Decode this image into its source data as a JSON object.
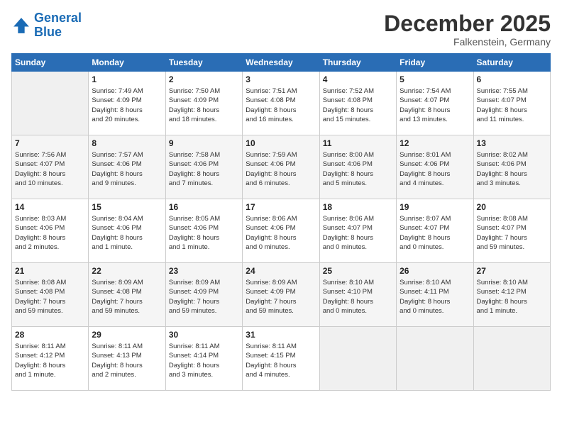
{
  "header": {
    "logo_line1": "General",
    "logo_line2": "Blue",
    "month": "December 2025",
    "location": "Falkenstein, Germany"
  },
  "weekdays": [
    "Sunday",
    "Monday",
    "Tuesday",
    "Wednesday",
    "Thursday",
    "Friday",
    "Saturday"
  ],
  "weeks": [
    [
      {
        "day": "",
        "info": ""
      },
      {
        "day": "1",
        "info": "Sunrise: 7:49 AM\nSunset: 4:09 PM\nDaylight: 8 hours\nand 20 minutes."
      },
      {
        "day": "2",
        "info": "Sunrise: 7:50 AM\nSunset: 4:09 PM\nDaylight: 8 hours\nand 18 minutes."
      },
      {
        "day": "3",
        "info": "Sunrise: 7:51 AM\nSunset: 4:08 PM\nDaylight: 8 hours\nand 16 minutes."
      },
      {
        "day": "4",
        "info": "Sunrise: 7:52 AM\nSunset: 4:08 PM\nDaylight: 8 hours\nand 15 minutes."
      },
      {
        "day": "5",
        "info": "Sunrise: 7:54 AM\nSunset: 4:07 PM\nDaylight: 8 hours\nand 13 minutes."
      },
      {
        "day": "6",
        "info": "Sunrise: 7:55 AM\nSunset: 4:07 PM\nDaylight: 8 hours\nand 11 minutes."
      }
    ],
    [
      {
        "day": "7",
        "info": "Sunrise: 7:56 AM\nSunset: 4:07 PM\nDaylight: 8 hours\nand 10 minutes."
      },
      {
        "day": "8",
        "info": "Sunrise: 7:57 AM\nSunset: 4:06 PM\nDaylight: 8 hours\nand 9 minutes."
      },
      {
        "day": "9",
        "info": "Sunrise: 7:58 AM\nSunset: 4:06 PM\nDaylight: 8 hours\nand 7 minutes."
      },
      {
        "day": "10",
        "info": "Sunrise: 7:59 AM\nSunset: 4:06 PM\nDaylight: 8 hours\nand 6 minutes."
      },
      {
        "day": "11",
        "info": "Sunrise: 8:00 AM\nSunset: 4:06 PM\nDaylight: 8 hours\nand 5 minutes."
      },
      {
        "day": "12",
        "info": "Sunrise: 8:01 AM\nSunset: 4:06 PM\nDaylight: 8 hours\nand 4 minutes."
      },
      {
        "day": "13",
        "info": "Sunrise: 8:02 AM\nSunset: 4:06 PM\nDaylight: 8 hours\nand 3 minutes."
      }
    ],
    [
      {
        "day": "14",
        "info": "Sunrise: 8:03 AM\nSunset: 4:06 PM\nDaylight: 8 hours\nand 2 minutes."
      },
      {
        "day": "15",
        "info": "Sunrise: 8:04 AM\nSunset: 4:06 PM\nDaylight: 8 hours\nand 1 minute."
      },
      {
        "day": "16",
        "info": "Sunrise: 8:05 AM\nSunset: 4:06 PM\nDaylight: 8 hours\nand 1 minute."
      },
      {
        "day": "17",
        "info": "Sunrise: 8:06 AM\nSunset: 4:06 PM\nDaylight: 8 hours\nand 0 minutes."
      },
      {
        "day": "18",
        "info": "Sunrise: 8:06 AM\nSunset: 4:07 PM\nDaylight: 8 hours\nand 0 minutes."
      },
      {
        "day": "19",
        "info": "Sunrise: 8:07 AM\nSunset: 4:07 PM\nDaylight: 8 hours\nand 0 minutes."
      },
      {
        "day": "20",
        "info": "Sunrise: 8:08 AM\nSunset: 4:07 PM\nDaylight: 7 hours\nand 59 minutes."
      }
    ],
    [
      {
        "day": "21",
        "info": "Sunrise: 8:08 AM\nSunset: 4:08 PM\nDaylight: 7 hours\nand 59 minutes."
      },
      {
        "day": "22",
        "info": "Sunrise: 8:09 AM\nSunset: 4:08 PM\nDaylight: 7 hours\nand 59 minutes."
      },
      {
        "day": "23",
        "info": "Sunrise: 8:09 AM\nSunset: 4:09 PM\nDaylight: 7 hours\nand 59 minutes."
      },
      {
        "day": "24",
        "info": "Sunrise: 8:09 AM\nSunset: 4:09 PM\nDaylight: 7 hours\nand 59 minutes."
      },
      {
        "day": "25",
        "info": "Sunrise: 8:10 AM\nSunset: 4:10 PM\nDaylight: 8 hours\nand 0 minutes."
      },
      {
        "day": "26",
        "info": "Sunrise: 8:10 AM\nSunset: 4:11 PM\nDaylight: 8 hours\nand 0 minutes."
      },
      {
        "day": "27",
        "info": "Sunrise: 8:10 AM\nSunset: 4:12 PM\nDaylight: 8 hours\nand 1 minute."
      }
    ],
    [
      {
        "day": "28",
        "info": "Sunrise: 8:11 AM\nSunset: 4:12 PM\nDaylight: 8 hours\nand 1 minute."
      },
      {
        "day": "29",
        "info": "Sunrise: 8:11 AM\nSunset: 4:13 PM\nDaylight: 8 hours\nand 2 minutes."
      },
      {
        "day": "30",
        "info": "Sunrise: 8:11 AM\nSunset: 4:14 PM\nDaylight: 8 hours\nand 3 minutes."
      },
      {
        "day": "31",
        "info": "Sunrise: 8:11 AM\nSunset: 4:15 PM\nDaylight: 8 hours\nand 4 minutes."
      },
      {
        "day": "",
        "info": ""
      },
      {
        "day": "",
        "info": ""
      },
      {
        "day": "",
        "info": ""
      }
    ]
  ]
}
